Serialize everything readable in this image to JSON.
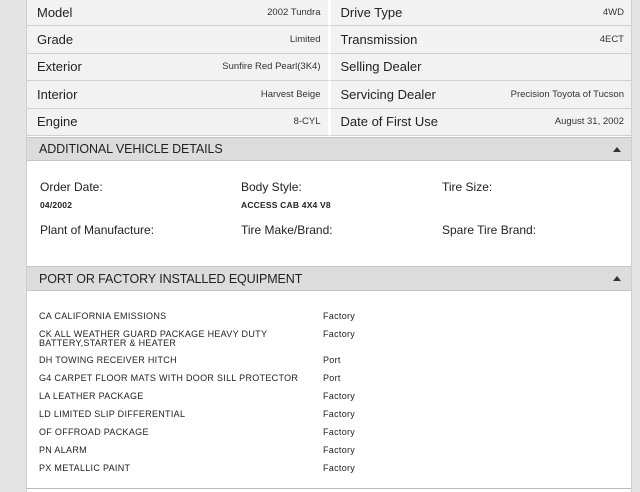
{
  "specs": [
    {
      "left_label": "Model",
      "left_value": "2002 Tundra",
      "right_label": "Drive Type",
      "right_value": "4WD"
    },
    {
      "left_label": "Grade",
      "left_value": "Limited",
      "right_label": "Transmission",
      "right_value": "4ECT"
    },
    {
      "left_label": "Exterior",
      "left_value": "Sunfire Red Pearl(3K4)",
      "right_label": "Selling Dealer",
      "right_value": ""
    },
    {
      "left_label": "Interior",
      "left_value": "Harvest Beige",
      "right_label": "Servicing Dealer",
      "right_value": "Precision Toyota of Tucson"
    },
    {
      "left_label": "Engine",
      "left_value": "8-CYL",
      "right_label": "Date of First Use",
      "right_value": "August 31, 2002"
    }
  ],
  "additional_details": {
    "title": "ADDITIONAL VEHICLE DETAILS",
    "items": [
      {
        "label": "Order Date:",
        "value": "04/2002"
      },
      {
        "label": "Body Style:",
        "value": "ACCESS CAB 4X4 V8"
      },
      {
        "label": "Tire Size:",
        "value": ""
      },
      {
        "label": "Plant of Manufacture:",
        "value": ""
      },
      {
        "label": "Tire Make/Brand:",
        "value": ""
      },
      {
        "label": "Spare Tire Brand:",
        "value": ""
      }
    ]
  },
  "equipment": {
    "title": "PORT OR FACTORY INSTALLED EQUIPMENT",
    "items": [
      {
        "name": "CA CALIFORNIA EMISSIONS",
        "source": "Factory"
      },
      {
        "name": "CK ALL WEATHER GUARD PACKAGE HEAVY DUTY BATTERY,STARTER & HEATER",
        "source": "Factory"
      },
      {
        "name": "DH TOWING RECEIVER HITCH",
        "source": "Port"
      },
      {
        "name": "G4 CARPET FLOOR MATS WITH DOOR SILL PROTECTOR",
        "source": "Port"
      },
      {
        "name": "LA LEATHER PACKAGE",
        "source": "Factory"
      },
      {
        "name": "LD LIMITED SLIP DIFFERENTIAL",
        "source": "Factory"
      },
      {
        "name": "OF OFFROAD PACKAGE",
        "source": "Factory"
      },
      {
        "name": "PN ALARM",
        "source": "Factory"
      },
      {
        "name": "PX METALLIC PAINT",
        "source": "Factory"
      }
    ]
  },
  "icons": {
    "collapse": "caret-up-icon"
  }
}
